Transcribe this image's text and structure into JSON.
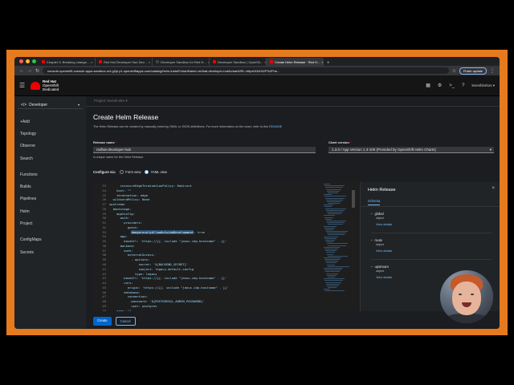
{
  "browser": {
    "tabs": [
      {
        "label": "Chapter 5: Breaking change...",
        "active": false
      },
      {
        "label": "Red Hat Developer Hub Dev...",
        "active": false
      },
      {
        "label": "Developer Sandbox for Red H...",
        "active": false
      },
      {
        "label": "Developer Sandbox | OpenSh...",
        "active": false
      },
      {
        "label": "Create Helm Release · Red H...",
        "active": true
      }
    ],
    "url": "console-openshift-console.apps.sandbox-m4.g2pi.p1.openshiftapps.com/catalog/helm-install?chartName=redhat-developer-hub&chartURL=https%3A%2F%2Fhe...",
    "finish_update": "Finish update"
  },
  "masthead": {
    "brand_line1": "Red Hat",
    "brand_line2": "OpenShift",
    "brand_line3": "Dedicated",
    "user": "leveshlorkos ▾"
  },
  "sidebar": {
    "perspective": "Developer",
    "items": [
      "+Add",
      "Topology",
      "Observe",
      "Search",
      "Functions",
      "Builds",
      "Pipelines",
      "Helm",
      "Project",
      "ConfigMaps",
      "Secrets"
    ]
  },
  "main": {
    "project_bar": "Project: levesh-dev ▾",
    "title": "Create Helm Release",
    "description": "The Helm Release can be created by manually entering YAML or JSON definitions. For more information on the chart, refer to this",
    "readme_link": "README",
    "release_name_label": "Release name",
    "release_name_value": "redhat-developer-hub",
    "release_name_help": "A unique name for the Helm Release.",
    "chart_version_label": "Chart version",
    "chart_version_value": "1.3.0 / App Version 1.3-100 (Provided by OpenShift Helm Charts)",
    "configure_via": "Configure via:",
    "form_view": "Form view",
    "yaml_view": "YAML view",
    "create": "Create",
    "cancel": "Cancel"
  },
  "editor": {
    "lines": [
      {
        "n": "23",
        "t": "      insecureEdgeTerminationPolicy: Redirect"
      },
      {
        "n": "24",
        "t": "    host: \"\""
      },
      {
        "n": "25",
        "t": "    termination: edge"
      },
      {
        "n": "26",
        "t": "  wildcardPolicy: None"
      },
      {
        "n": "27",
        "t": "upstream:"
      },
      {
        "n": "28",
        "t": "  backstage:"
      },
      {
        "n": "29",
        "t": "    appConfig:"
      },
      {
        "n": "30",
        "t": "      auth:"
      },
      {
        "n": "31",
        "t": "        providers:"
      },
      {
        "n": "32",
        "t": "          guest:"
      },
      {
        "n": "33",
        "t": "            dangerouslyAllowOutsideDevelopment: true"
      },
      {
        "n": "34",
        "t": "      app:"
      },
      {
        "n": "35",
        "t": "        baseUrl: 'https://{{- include \"janus-idp.hostname\" . }}'"
      },
      {
        "n": "36",
        "t": "      backend:"
      },
      {
        "n": "37",
        "t": "        auth:"
      },
      {
        "n": "38",
        "t": "          externalAccess:"
      },
      {
        "n": "39",
        "t": "            - options:"
      },
      {
        "n": "40",
        "t": "                secret: '${BACKEND_SECRET}'"
      },
      {
        "n": "41",
        "t": "                subject: legacy-default-config"
      },
      {
        "n": "42",
        "t": "              type: legacy"
      },
      {
        "n": "43",
        "t": "        baseUrl: 'https://{{- include \"janus-idp.hostname\" . }}'"
      },
      {
        "n": "44",
        "t": "        cors:"
      },
      {
        "n": "45",
        "t": "          origin: 'https://{{- include \"janus-idp.hostname\" . }}'"
      },
      {
        "n": "46",
        "t": "        database:"
      },
      {
        "n": "47",
        "t": "          connection:"
      },
      {
        "n": "48",
        "t": "            password: '${POSTGRESQL_ADMIN_PASSWORD}'"
      },
      {
        "n": "49",
        "t": "            user: postgres"
      },
      {
        "n": "50",
        "t": "    args: []"
      }
    ]
  },
  "schema_panel": {
    "title": "Helm Release",
    "tab": "Schema",
    "items": [
      {
        "name": "global",
        "type": "object",
        "link": "View details"
      },
      {
        "name": "route",
        "type": "object",
        "link": "View details"
      },
      {
        "name": "upstream",
        "type": "object",
        "link": "View details"
      }
    ]
  },
  "colors": {
    "accent": "#0066cc",
    "link": "#73bcf7",
    "frame": "#e67a1e",
    "brand_red": "#ee0000"
  }
}
